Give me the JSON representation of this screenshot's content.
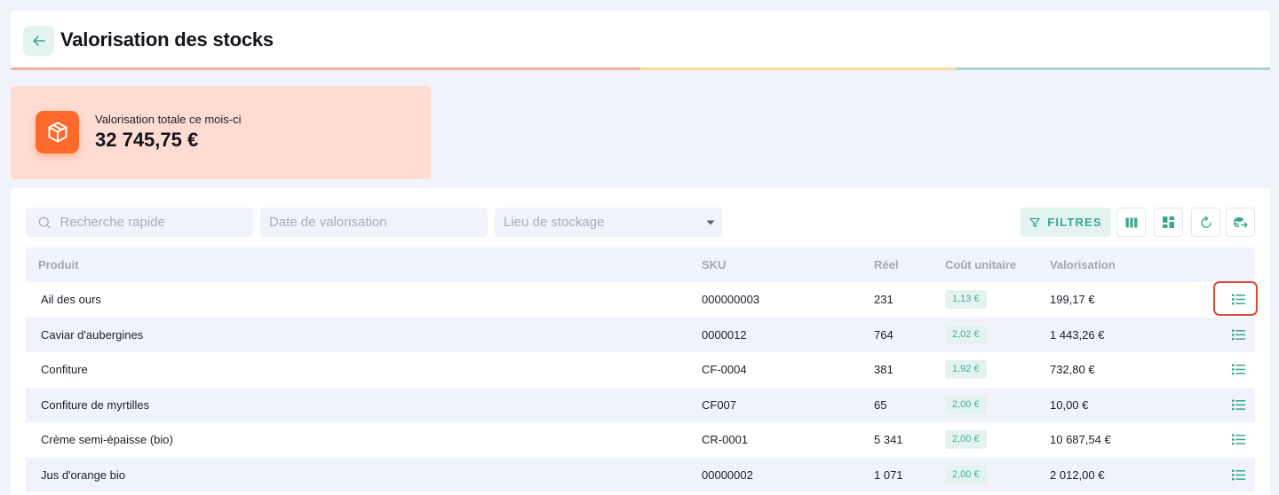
{
  "header": {
    "title": "Valorisation des stocks",
    "progress_colors": [
      "#f4b0a6",
      "#f4b0a6",
      "#f6dea0",
      "#a3d8cd"
    ]
  },
  "kpi": {
    "label": "Valorisation totale ce mois-ci",
    "value": "32 745,75 €",
    "icon": "cube-icon",
    "color": "#fd6a2b"
  },
  "toolbar": {
    "search_placeholder": "Recherche rapide",
    "date_placeholder": "Date de valorisation",
    "lieu_placeholder": "Lieu de stockage",
    "filters_label": "FILTRES",
    "tools": [
      "columns-icon",
      "dashboard-icon",
      "refresh-icon",
      "export-icon"
    ]
  },
  "table": {
    "columns": {
      "produit": "Produit",
      "sku": "SKU",
      "reel": "Réel",
      "cout": "Coût unitaire",
      "valo": "Valorisation"
    },
    "rows": [
      {
        "produit": "Ail des ours",
        "sku": "000000003",
        "reel": "231",
        "cout": "1,13 €",
        "valo": "199,17 €"
      },
      {
        "produit": "Caviar d'aubergines",
        "sku": "0000012",
        "reel": "764",
        "cout": "2,02 €",
        "valo": "1 443,26 €"
      },
      {
        "produit": "Confiture",
        "sku": "CF-0004",
        "reel": "381",
        "cout": "1,92 €",
        "valo": "732,80 €"
      },
      {
        "produit": "Confiture de myrtilles",
        "sku": "CF007",
        "reel": "65",
        "cout": "2,00 €",
        "valo": "10,00 €"
      },
      {
        "produit": "Crème semi-épaisse (bio)",
        "sku": "CR-0001",
        "reel": "5 341",
        "cout": "2,00 €",
        "valo": "10 687,54 €"
      },
      {
        "produit": "Jus d'orange bio",
        "sku": "00000002",
        "reel": "1 071",
        "cout": "2,00 €",
        "valo": "2 012,00 €"
      }
    ]
  },
  "colors": {
    "accent": "#39a88d",
    "accent_light": "#e3f3ef",
    "kpi_bg": "#fedcd2",
    "highlight": "#dc4a3a"
  }
}
